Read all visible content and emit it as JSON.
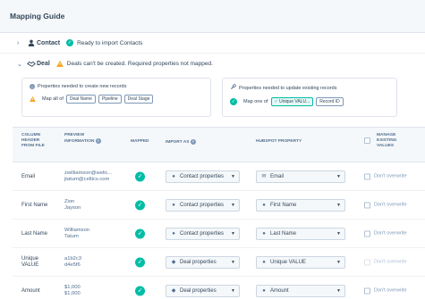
{
  "header": {
    "title": "Mapping Guide"
  },
  "contact": {
    "name": "Contact",
    "status": "Ready to import Contacts",
    "chevron_icon": "chevron-right-icon",
    "object_icon": "contact-icon"
  },
  "deal": {
    "name": "Deal",
    "status": "Deals can't be created. Required properties not mapped.",
    "chevron_icon": "chevron-down-icon",
    "object_icon": "deal-icon"
  },
  "panels": {
    "create": {
      "title": "Properties needed to create new records",
      "map_label": "Map all of",
      "tags": [
        "Deal Name",
        "Pipeline",
        "Deal Stage"
      ]
    },
    "update": {
      "title": "Properties needed to update existing records",
      "map_label": "Map one of",
      "tags": [
        "Unique VALU...",
        "Record ID"
      ]
    }
  },
  "table": {
    "headers": {
      "column": [
        "COLUMN",
        "HEADER",
        "FROM FILE"
      ],
      "preview": [
        "PREVIEW",
        "INFORMATION"
      ],
      "mapped": "MAPPED",
      "import_as": "IMPORT AS",
      "hubspot": "HUBSPOT PROPERTY",
      "manage": [
        "MANAGE",
        "EXISTING",
        "VALUES"
      ]
    },
    "rows": [
      {
        "column": "Email",
        "preview": [
          "zwilliamson@welic...",
          "jtatum@celtics.com"
        ],
        "import_as": "Contact properties",
        "import_icon": "contact-icon",
        "property": "Email",
        "property_icon": "email-icon",
        "manage": "Don't overwrite",
        "dim": false
      },
      {
        "column": "First Name",
        "preview": [
          "Zion",
          "Jayson"
        ],
        "import_as": "Contact properties",
        "import_icon": "contact-icon",
        "property": "First Name",
        "property_icon": "text-icon",
        "manage": "Don't overwrite",
        "dim": false
      },
      {
        "column": "Last Name",
        "preview": [
          "Williamson",
          "Tatum"
        ],
        "import_as": "Contact properties",
        "import_icon": "contact-icon",
        "property": "Last Name",
        "property_icon": "text-icon",
        "manage": "Don't overwrite",
        "dim": false
      },
      {
        "column": "Unique VALUE",
        "preview": [
          "a1b2c3",
          "d4e5f6"
        ],
        "import_as": "Deal properties",
        "import_icon": "deal-icon",
        "property": "Unique VALUE",
        "property_icon": "text-icon",
        "manage": "Don't overwrite",
        "dim": true
      },
      {
        "column": "Amount",
        "preview": [
          "$1,000",
          "$1,000"
        ],
        "import_as": "Deal properties",
        "import_icon": "deal-icon",
        "property": "Amount",
        "property_icon": "text-icon",
        "manage": "Don't overwrite",
        "dim": false
      }
    ]
  },
  "colors": {
    "success": "#00bda5",
    "warning": "#f5a623",
    "header_bg": "#f5f8fa",
    "text": "#33475b"
  }
}
